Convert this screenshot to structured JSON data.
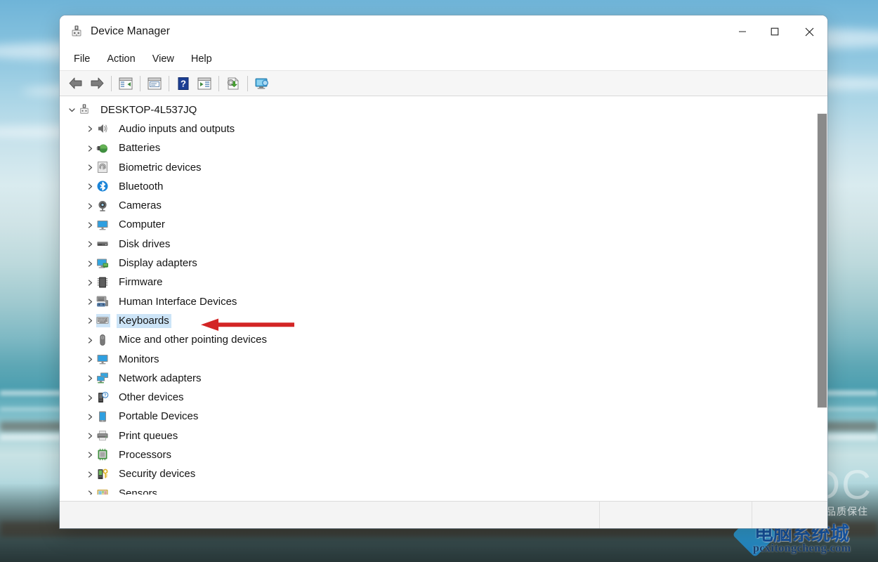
{
  "window": {
    "title": "Device Manager",
    "icon": "device-manager-icon",
    "controls": {
      "minimize": "—",
      "maximize": "□",
      "close": "✕",
      "minimize_name": "minimize-button",
      "maximize_name": "maximize-button",
      "close_name": "close-button"
    }
  },
  "menubar": {
    "items": [
      {
        "label": "File",
        "name": "menu-file"
      },
      {
        "label": "Action",
        "name": "menu-action"
      },
      {
        "label": "View",
        "name": "menu-view"
      },
      {
        "label": "Help",
        "name": "menu-help"
      }
    ]
  },
  "toolbar": {
    "buttons": [
      {
        "name": "back-button",
        "icon": "back-arrow-icon",
        "tooltip": "Back"
      },
      {
        "name": "forward-button",
        "icon": "forward-arrow-icon",
        "tooltip": "Forward"
      },
      {
        "name": "show-hide-console-tree-button",
        "icon": "console-tree-icon",
        "tooltip": "Show/Hide Console Tree"
      },
      {
        "name": "properties-button",
        "icon": "properties-icon",
        "tooltip": "Properties"
      },
      {
        "name": "help-button",
        "icon": "help-question-icon",
        "tooltip": "Help"
      },
      {
        "name": "show-hide-action-pane-button",
        "icon": "action-pane-icon",
        "tooltip": "Show/Hide Action Pane"
      },
      {
        "name": "update-driver-button",
        "icon": "update-driver-icon",
        "tooltip": "Update Driver Software"
      },
      {
        "name": "scan-hardware-changes-button",
        "icon": "scan-hardware-icon",
        "tooltip": "Scan for hardware changes"
      }
    ]
  },
  "tree": {
    "root": {
      "label": "DESKTOP-4L537JQ",
      "icon": "computer-root-icon",
      "expanded": true,
      "chevron": "⌄"
    },
    "items": [
      {
        "label": "Audio inputs and outputs",
        "icon": "speaker-icon",
        "selected": false
      },
      {
        "label": "Batteries",
        "icon": "battery-icon",
        "selected": false
      },
      {
        "label": "Biometric devices",
        "icon": "fingerprint-icon",
        "selected": false
      },
      {
        "label": "Bluetooth",
        "icon": "bluetooth-icon",
        "selected": false
      },
      {
        "label": "Cameras",
        "icon": "camera-icon",
        "selected": false
      },
      {
        "label": "Computer",
        "icon": "monitor-icon",
        "selected": false
      },
      {
        "label": "Disk drives",
        "icon": "disk-drive-icon",
        "selected": false
      },
      {
        "label": "Display adapters",
        "icon": "display-adapter-icon",
        "selected": false
      },
      {
        "label": "Firmware",
        "icon": "firmware-chip-icon",
        "selected": false
      },
      {
        "label": "Human Interface Devices",
        "icon": "hid-icon",
        "selected": false
      },
      {
        "label": "Keyboards",
        "icon": "keyboard-icon",
        "selected": true
      },
      {
        "label": "Mice and other pointing devices",
        "icon": "mouse-icon",
        "selected": false
      },
      {
        "label": "Monitors",
        "icon": "monitor-icon",
        "selected": false
      },
      {
        "label": "Network adapters",
        "icon": "network-adapter-icon",
        "selected": false
      },
      {
        "label": "Other devices",
        "icon": "unknown-device-icon",
        "selected": false
      },
      {
        "label": "Portable Devices",
        "icon": "portable-device-icon",
        "selected": false
      },
      {
        "label": "Print queues",
        "icon": "printer-icon",
        "selected": false
      },
      {
        "label": "Processors",
        "icon": "processor-icon",
        "selected": false
      },
      {
        "label": "Security devices",
        "icon": "security-device-icon",
        "selected": false
      },
      {
        "label": "Sensors",
        "icon": "sensor-icon",
        "selected": false
      }
    ],
    "child_chevron": "›"
  },
  "statusbar": {
    "pane1": "",
    "pane2": "",
    "pane3": ""
  },
  "annotation": {
    "arrow": "left-pointing-red-arrow",
    "color": "#d32525",
    "points_to": "Keyboards"
  },
  "watermarks": {
    "mdc": "MDC",
    "cn_small": "品质保住",
    "cn_big": "电脑系统城",
    "url": "pcxitongcheng.com"
  },
  "colors": {
    "selection": "#cce4f7",
    "accent_red": "#d32525",
    "window_bg": "#ffffff",
    "toolbar_bg": "#f6f6f6",
    "statusbar_bg": "#f4f4f4",
    "scrollbar_thumb": "#8a8a8a"
  }
}
